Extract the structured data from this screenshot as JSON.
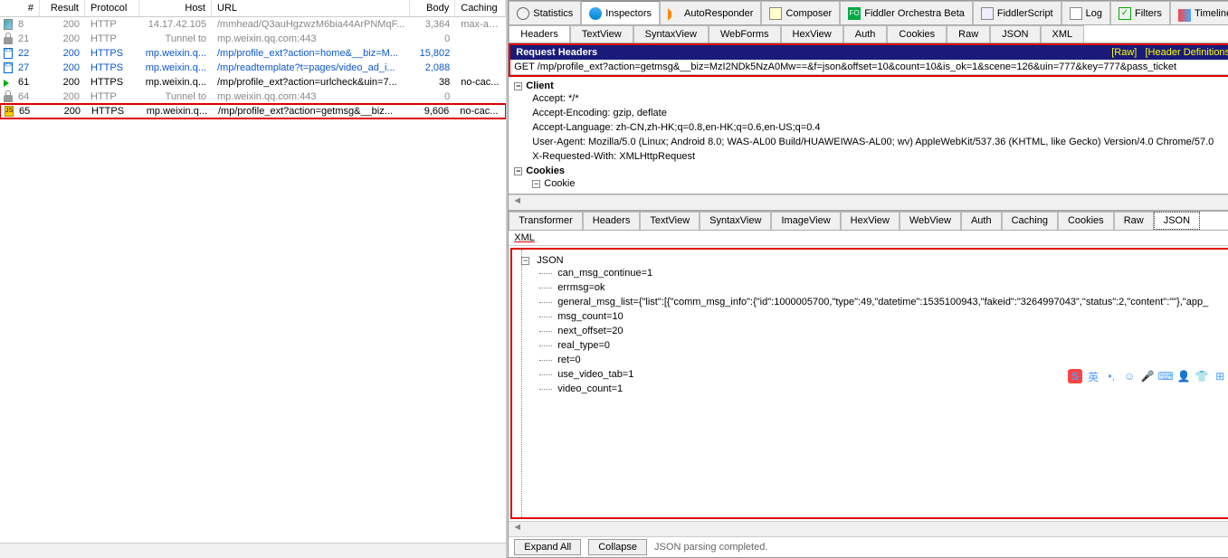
{
  "sessions": {
    "columns": {
      "num": "#",
      "result": "Result",
      "protocol": "Protocol",
      "host": "Host",
      "url": "URL",
      "body": "Body",
      "caching": "Caching"
    },
    "rows": [
      {
        "num": "8",
        "result": "200",
        "protocol": "HTTP",
        "host": "14.17.42.105",
        "url": "/mmhead/Q3auHgzwzM6bia44ArPNMqF...",
        "body": "3,364",
        "caching": "max-ag...",
        "style": "gray",
        "icon": "img"
      },
      {
        "num": "21",
        "result": "200",
        "protocol": "HTTP",
        "host": "Tunnel to",
        "url": "mp.weixin.qq.com:443",
        "body": "0",
        "caching": "",
        "style": "gray",
        "icon": "lock"
      },
      {
        "num": "22",
        "result": "200",
        "protocol": "HTTPS",
        "host": "mp.weixin.q...",
        "url": "/mp/profile_ext?action=home&__biz=M...",
        "body": "15,802",
        "caching": "",
        "style": "blue",
        "icon": "doc"
      },
      {
        "num": "27",
        "result": "200",
        "protocol": "HTTPS",
        "host": "mp.weixin.q...",
        "url": "/mp/readtemplate?t=pages/video_ad_i...",
        "body": "2,088",
        "caching": "",
        "style": "blue",
        "icon": "doc"
      },
      {
        "num": "61",
        "result": "200",
        "protocol": "HTTPS",
        "host": "mp.weixin.q...",
        "url": "/mp/profile_ext?action=urlcheck&uin=7...",
        "body": "38",
        "caching": "no-cac...",
        "style": "",
        "icon": "arrow"
      },
      {
        "num": "64",
        "result": "200",
        "protocol": "HTTP",
        "host": "Tunnel to",
        "url": "mp.weixin.qq.com:443",
        "body": "0",
        "caching": "",
        "style": "gray",
        "icon": "lock"
      },
      {
        "num": "65",
        "result": "200",
        "protocol": "HTTPS",
        "host": "mp.weixin.q...",
        "url": "/mp/profile_ext?action=getmsg&__biz...",
        "body": "9,606",
        "caching": "no-cac...",
        "style": "",
        "icon": "js",
        "selected": true
      }
    ]
  },
  "topTabs": [
    {
      "label": "Statistics",
      "icon": "stats"
    },
    {
      "label": "Inspectors",
      "icon": "insp",
      "active": true
    },
    {
      "label": "AutoResponder",
      "icon": "auto"
    },
    {
      "label": "Composer",
      "icon": "comp"
    },
    {
      "label": "Fiddler Orchestra Beta",
      "icon": "orch"
    },
    {
      "label": "FiddlerScript",
      "icon": "fs"
    },
    {
      "label": "Log",
      "icon": "log"
    },
    {
      "label": "Filters",
      "icon": "fil"
    },
    {
      "label": "Timeline",
      "icon": "tl"
    }
  ],
  "reqTabs": [
    "Headers",
    "TextView",
    "SyntaxView",
    "WebForms",
    "HexView",
    "Auth",
    "Cookies",
    "Raw",
    "JSON",
    "XML"
  ],
  "reqHeader": {
    "title": "Request Headers",
    "rawLink": "[Raw]",
    "defLink": "[Header Definitions]",
    "line": "GET /mp/profile_ext?action=getmsg&__biz=MzI2NDk5NzA0Mw==&f=json&offset=10&count=10&is_ok=1&scene=126&uin=777&key=777&pass_ticket"
  },
  "headerTree": {
    "client": "Client",
    "accept": "Accept: */*",
    "acceptEnc": "Accept-Encoding: gzip, deflate",
    "acceptLang": "Accept-Language: zh-CN,zh-HK;q=0.8,en-HK;q=0.6,en-US;q=0.4",
    "ua": "User-Agent: Mozilla/5.0 (Linux; Android 8.0; WAS-AL00 Build/HUAWEIWAS-AL00; wv) AppleWebKit/537.36 (KHTML, like Gecko) Version/4.0 Chrome/57.0",
    "xreq": "X-Requested-With: XMLHttpRequest",
    "cookies": "Cookies",
    "cookie": "Cookie"
  },
  "respTabs": [
    "Transformer",
    "Headers",
    "TextView",
    "SyntaxView",
    "ImageView",
    "HexView",
    "WebView",
    "Auth",
    "Caching",
    "Cookies",
    "Raw",
    "JSON"
  ],
  "xmlLabel": "XML",
  "jsonView": {
    "root": "JSON",
    "items": [
      "can_msg_continue=1",
      "errmsg=ok",
      "general_msg_list={\"list\":[{\"comm_msg_info\":{\"id\":1000005700,\"type\":49,\"datetime\":1535100943,\"fakeid\":\"3264997043\",\"status\":2,\"content\":\"\"},\"app_",
      "msg_count=10",
      "next_offset=20",
      "real_type=0",
      "ret=0",
      "use_video_tab=1",
      "video_count=1"
    ]
  },
  "bottom": {
    "expand": "Expand All",
    "collapse": "Collapse",
    "status": "JSON parsing completed."
  },
  "ime": [
    "S",
    "英",
    "",
    "☺",
    "🎤",
    "⌨",
    "👤",
    "👕",
    "⊞"
  ]
}
